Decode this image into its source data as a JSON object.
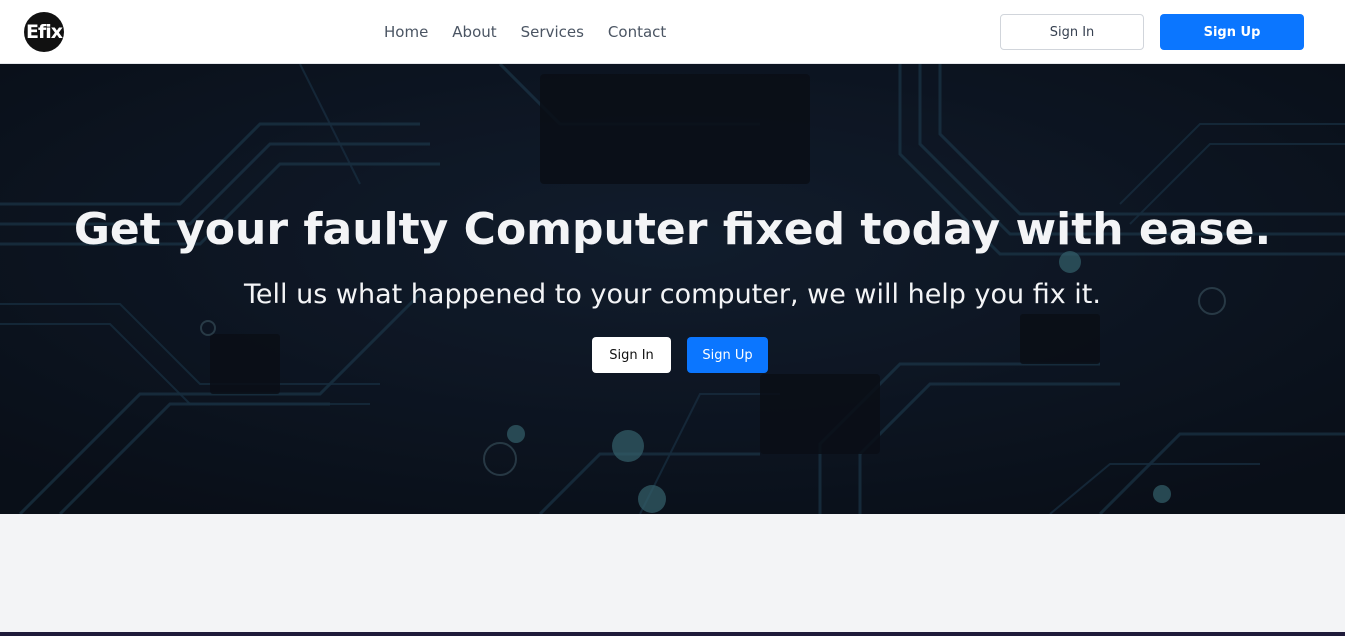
{
  "brand": {
    "logo_text": "Efix"
  },
  "nav": {
    "links": [
      {
        "label": "Home"
      },
      {
        "label": "About"
      },
      {
        "label": "Services"
      },
      {
        "label": "Contact"
      }
    ],
    "sign_in_label": "Sign In",
    "sign_up_label": "Sign Up"
  },
  "hero": {
    "title": "Get your faulty Computer fixed today with ease.",
    "subtitle": "Tell us what happened to your computer, we will help you fix it.",
    "sign_in_label": "Sign In",
    "sign_up_label": "Sign Up"
  },
  "colors": {
    "primary": "#0b76ff",
    "nav_text": "#4b5563",
    "hero_bg": "#0e1723",
    "page_bg": "#f3f4f6"
  }
}
